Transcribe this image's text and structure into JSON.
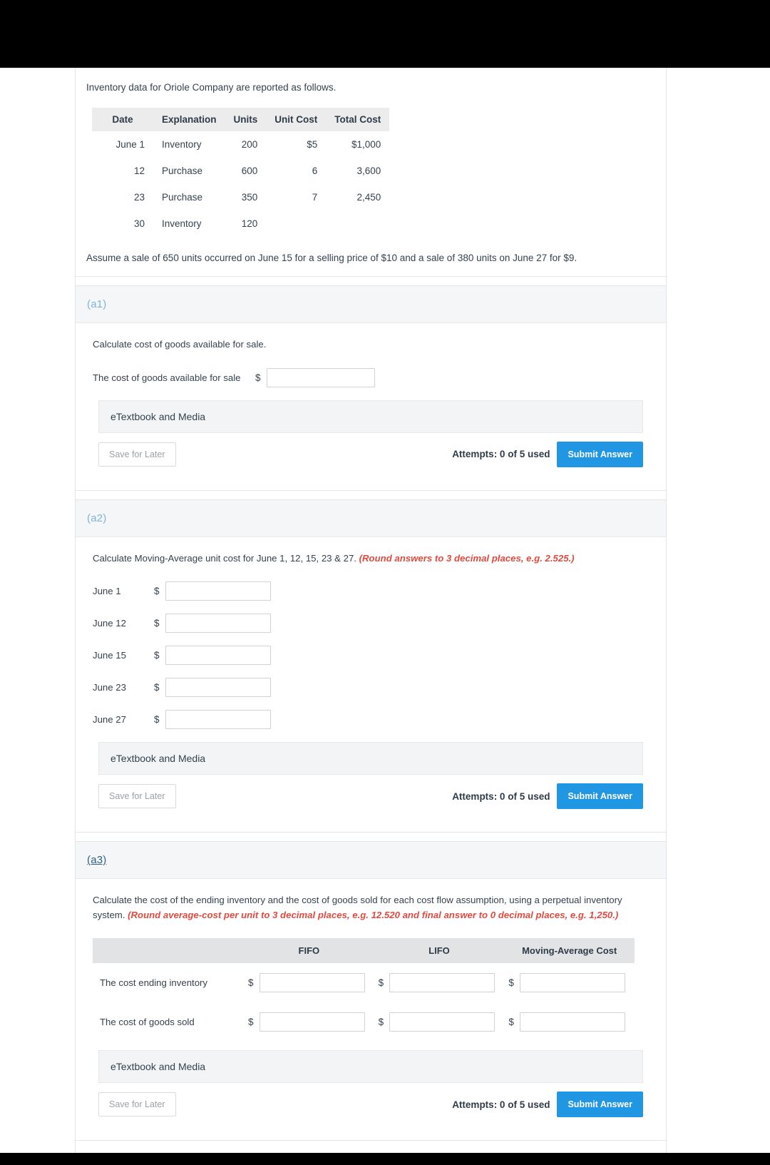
{
  "intro": {
    "text": "Inventory data for Oriole Company are reported as follows.",
    "sale_note": "Assume a sale of 650 units occurred on June 15 for a selling price of $10 and a sale of 380 units on June 27 for $9."
  },
  "inventory_table": {
    "headers": [
      "Date",
      "Explanation",
      "Units",
      "Unit Cost",
      "Total Cost"
    ],
    "rows": [
      {
        "date": "June 1",
        "explanation": "Inventory",
        "units": "200",
        "unit_cost": "$5",
        "total_cost": "$1,000"
      },
      {
        "date": "12",
        "explanation": "Purchase",
        "units": "600",
        "unit_cost": "6",
        "total_cost": "3,600"
      },
      {
        "date": "23",
        "explanation": "Purchase",
        "units": "350",
        "unit_cost": "7",
        "total_cost": "2,450"
      },
      {
        "date": "30",
        "explanation": "Inventory",
        "units": "120",
        "unit_cost": "",
        "total_cost": ""
      }
    ]
  },
  "common": {
    "etextbook_label": "eTextbook and Media",
    "save_label": "Save for Later",
    "attempts_label": "Attempts: 0 of 5 used",
    "submit_label": "Submit Answer",
    "dollar": "$",
    "input_value": "",
    "input_placeholder": ""
  },
  "part_a1": {
    "label": "(a1)",
    "prompt": "Calculate cost of goods available for sale.",
    "answer_label": "The cost of goods available for sale"
  },
  "part_a2": {
    "label": "(a2)",
    "prompt_main": "Calculate Moving-Average unit cost for June 1, 12, 15, 23 & 27. ",
    "prompt_hint": "(Round answers to 3 decimal places, e.g. 2.525.)",
    "rows": [
      {
        "label": "June 1"
      },
      {
        "label": "June 12"
      },
      {
        "label": "June 15"
      },
      {
        "label": "June 23"
      },
      {
        "label": "June 27"
      }
    ]
  },
  "part_a3": {
    "label": "(a3)",
    "prompt_main": "Calculate the cost of the ending inventory and the cost of goods sold for each cost flow assumption, using a perpetual inventory system. ",
    "prompt_hint": "(Round average-cost per unit to 3 decimal places, e.g. 12.520 and final answer to 0 decimal places, e.g. 1,250.)",
    "headers": [
      "",
      "FIFO",
      "LIFO",
      "Moving-Average Cost"
    ],
    "rows": [
      {
        "label": "The cost ending inventory"
      },
      {
        "label": "The cost of goods sold"
      }
    ]
  },
  "colors": {
    "accent": "#2196e3",
    "part_label": "#7fb3d9",
    "hint_red": "#e04a3f",
    "header_gray": "#ececec"
  }
}
